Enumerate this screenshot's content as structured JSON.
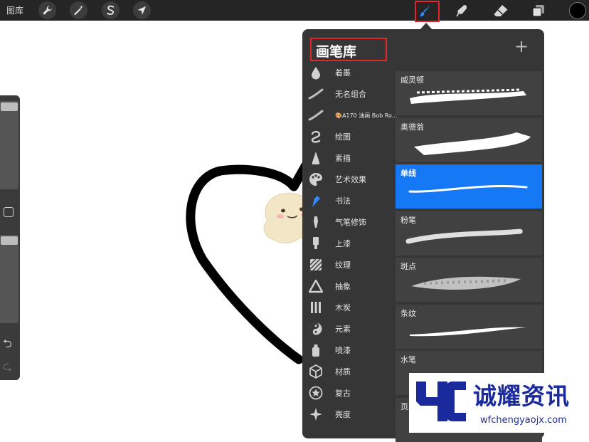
{
  "toolbar": {
    "gallery_label": "图库",
    "actions_icon": "wrench-icon",
    "adjustments_icon": "magic-wand-icon",
    "selection_icon": "selection-s-icon",
    "transform_icon": "arrow-cursor-icon",
    "brush_icon": "paintbrush-icon",
    "smudge_icon": "smudge-finger-icon",
    "eraser_icon": "eraser-icon",
    "layers_icon": "layers-icon",
    "color": "#000000"
  },
  "brush_library": {
    "title": "画笔库",
    "add_label": "+",
    "categories": [
      {
        "label": "着墨",
        "icon": "ink-drop-icon"
      },
      {
        "label": "无名组合",
        "icon": "stroke-icon"
      },
      {
        "label": "🎨A170 油画 Bob Ro...",
        "icon": "stroke-icon"
      },
      {
        "label": "绘图",
        "icon": "swirl-icon"
      },
      {
        "label": "素描",
        "icon": "pencil-tip-icon"
      },
      {
        "label": "艺术效果",
        "icon": "palette-icon"
      },
      {
        "label": "书法",
        "icon": "calligraphy-pen-icon"
      },
      {
        "label": "气笔修饰",
        "icon": "airbrush-icon"
      },
      {
        "label": "上漆",
        "icon": "paint-tube-icon"
      },
      {
        "label": "纹理",
        "icon": "texture-icon"
      },
      {
        "label": "抽象",
        "icon": "triangle-icon"
      },
      {
        "label": "木炭",
        "icon": "charcoal-icon"
      },
      {
        "label": "元素",
        "icon": "yin-yang-icon"
      },
      {
        "label": "喷漆",
        "icon": "spray-can-icon"
      },
      {
        "label": "材质",
        "icon": "cube-icon"
      },
      {
        "label": "复古",
        "icon": "star-badge-icon"
      },
      {
        "label": "亮度",
        "icon": "sparkle-icon"
      }
    ],
    "brushes": [
      {
        "name": "威灵顿",
        "selected": false
      },
      {
        "name": "奥德翁",
        "selected": false
      },
      {
        "name": "单线",
        "selected": true
      },
      {
        "name": "粉笔",
        "selected": false
      },
      {
        "name": "斑点",
        "selected": false
      },
      {
        "name": "条纹",
        "selected": false
      },
      {
        "name": "水笔",
        "selected": false
      },
      {
        "name": "页岩",
        "selected": false
      }
    ]
  },
  "watermark": {
    "title": "诚耀资讯",
    "url": "wfchengyaojx.com"
  },
  "colors": {
    "toolbar_bg": "#252525",
    "panel_bg": "#363636",
    "brush_card_bg": "#414141",
    "selected_accent": "#1578f5",
    "highlight_red": "#e2262b"
  }
}
